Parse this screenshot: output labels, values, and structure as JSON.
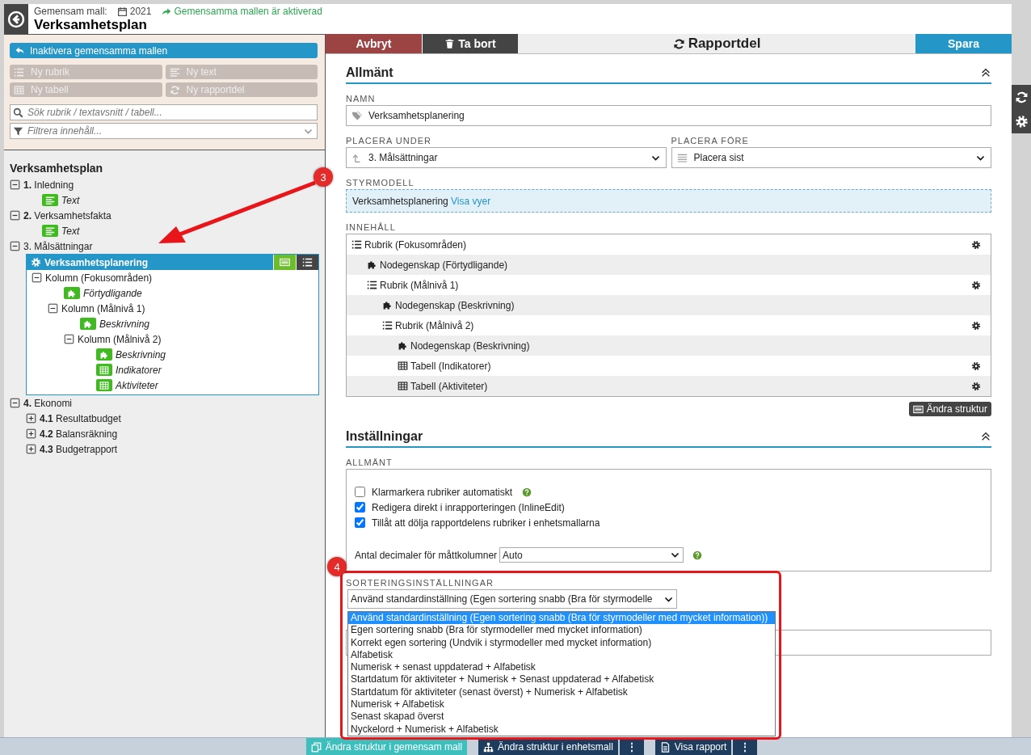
{
  "header": {
    "label": "Gemensam mall:",
    "year": "2021",
    "status": "Gemensamma mallen är aktiverad",
    "title": "Verksamhetsplan"
  },
  "sidebar": {
    "primary_button": "Inaktivera gemensamma mallen",
    "buttons": [
      {
        "label": "Ny rubrik",
        "kind": "rubrik",
        "disabled": true
      },
      {
        "label": "Ny text",
        "kind": "text",
        "disabled": true
      },
      {
        "label": "Ny tabell",
        "kind": "table",
        "disabled": true
      },
      {
        "label": "Ny rapportdel",
        "kind": "part",
        "disabled": true
      }
    ],
    "search": {
      "placeholder": "Sök rubrik / textavsnitt / tabell..."
    },
    "filter": {
      "placeholder": "Filtrera innehåll..."
    }
  },
  "tree": {
    "title": "Verksamhetsplan",
    "items": [
      {
        "kind": "heading",
        "label": "**1.** Inledning",
        "expanded": true,
        "children": [
          {
            "kind": "text",
            "label": "Text"
          }
        ]
      },
      {
        "kind": "heading",
        "label": "**2.** Verksamhetsfakta",
        "expanded": true,
        "children": [
          {
            "kind": "text",
            "label": "Text"
          }
        ]
      },
      {
        "kind": "heading",
        "label": "3. Målsättningar",
        "expanded": true,
        "children": [
          {
            "kind": "part",
            "label": "Verksamhetsplanering",
            "selected": true,
            "children": [
              {
                "kind": "column",
                "label": "Kolumn (Fokusområden)",
                "expanded": true,
                "children": [
                  {
                    "kind": "property",
                    "label": "Förtydligande"
                  },
                  {
                    "kind": "column",
                    "label": "Kolumn (Målnivå 1)",
                    "expanded": true,
                    "children": [
                      {
                        "kind": "property",
                        "label": "Beskrivning"
                      },
                      {
                        "kind": "column",
                        "label": "Kolumn (Målnivå 2)",
                        "expanded": true,
                        "children": [
                          {
                            "kind": "property",
                            "label": "Beskrivning"
                          },
                          {
                            "kind": "table",
                            "label": "Indikatorer"
                          },
                          {
                            "kind": "table",
                            "label": "Aktiviteter"
                          }
                        ]
                      }
                    ]
                  }
                ]
              }
            ]
          }
        ]
      },
      {
        "kind": "heading",
        "label": "**4.** Ekonomi",
        "expanded": true,
        "children": [
          {
            "kind": "heading",
            "label": "**4.1** Resultatbudget",
            "expanded": false
          },
          {
            "kind": "heading",
            "label": "**4.2** Balansräkning",
            "expanded": false
          },
          {
            "kind": "heading",
            "label": "**4.3** Budgetrapport",
            "expanded": false
          }
        ]
      }
    ]
  },
  "toolbar": {
    "cancel": "Avbryt",
    "delete": "Ta bort",
    "title": "Rapportdel",
    "save": "Spara"
  },
  "general": {
    "heading": "Allmänt",
    "name": {
      "label": "NAMN",
      "value": "Verksamhetsplanering"
    },
    "place_under": {
      "label": "PLACERA UNDER",
      "value": "3. Målsättningar"
    },
    "place_before": {
      "label": "PLACERA FÖRE",
      "value": "Placera sist"
    },
    "control_model": {
      "label": "STYRMODELL",
      "value": "Verksamhetsplanering",
      "link": "Visa vyer"
    },
    "contents": {
      "label": "INNEHÅLL",
      "rows": [
        {
          "kind": "rubrik",
          "label": "Rubrik (Fokusområden)",
          "children": [
            {
              "kind": "property",
              "label": "Nodegenskap (Förtydligande)"
            },
            {
              "kind": "rubrik",
              "label": "Rubrik (Målnivå 1)",
              "children": [
                {
                  "kind": "property",
                  "label": "Nodegenskap (Beskrivning)"
                },
                {
                  "kind": "rubrik",
                  "label": "Rubrik (Målnivå 2)",
                  "children": [
                    {
                      "kind": "property",
                      "label": "Nodegenskap (Beskrivning)"
                    },
                    {
                      "kind": "table",
                      "label": "Tabell (Indikatorer)"
                    },
                    {
                      "kind": "table",
                      "label": "Tabell (Aktiviteter)"
                    }
                  ]
                }
              ]
            }
          ]
        }
      ]
    },
    "change_structure": "Ändra struktur"
  },
  "settings": {
    "heading": "Inställningar",
    "group_label": "ALLMÄNT",
    "checkboxes": [
      {
        "label": "Klarmarkera rubriker automatiskt",
        "checked": false,
        "help": true
      },
      {
        "label": "Redigera direkt i inrapporteringen (InlineEdit)",
        "checked": true,
        "help": false
      },
      {
        "label": "Tillåt att dölja rapportdelens rubriker i enhetsmallarna",
        "checked": true,
        "help": false
      }
    ],
    "decimals": {
      "label": "Antal decimaler för måttkolumner",
      "value": "Auto"
    },
    "sorting": {
      "label": "SORTERINGSINSTÄLLNINGAR",
      "value": "Använd standardinställning (Egen sortering snabb (Bra för styrmodelle",
      "options": [
        {
          "label": "Använd standardinställning (Egen sortering snabb (Bra för styrmodeller med mycket information))",
          "selected": true
        },
        {
          "label": "Egen sortering snabb (Bra för styrmodeller med mycket information)",
          "selected": false
        },
        {
          "label": "Korrekt egen sortering (Undvik i styrmodeller med mycket information)",
          "selected": false
        },
        {
          "label": "Alfabetisk",
          "selected": false
        },
        {
          "label": "Numerisk + senast uppdaterad + Alfabetisk",
          "selected": false
        },
        {
          "label": "Startdatum för aktiviteter + Numerisk + Senast uppdaterad + Alfabetisk",
          "selected": false
        },
        {
          "label": "Startdatum för aktiviteter (senast överst) + Numerisk + Alfabetisk",
          "selected": false
        },
        {
          "label": "Numerisk + Alfabetisk",
          "selected": false
        },
        {
          "label": "Senast skapad överst",
          "selected": false
        },
        {
          "label": "Nyckelord + Numerisk + Alfabetisk",
          "selected": false
        }
      ]
    }
  },
  "bottom_bar": {
    "buttons": [
      {
        "kind": "shared",
        "label": "Ändra struktur i gemensam mall"
      },
      {
        "kind": "unit",
        "label": "Ändra struktur i enhetsmall",
        "menu": "⋮"
      },
      {
        "kind": "report",
        "label": "Visa rapport",
        "menu": "⋮"
      }
    ]
  },
  "annotations": [
    {
      "label": "3"
    },
    {
      "label": "4"
    }
  ]
}
